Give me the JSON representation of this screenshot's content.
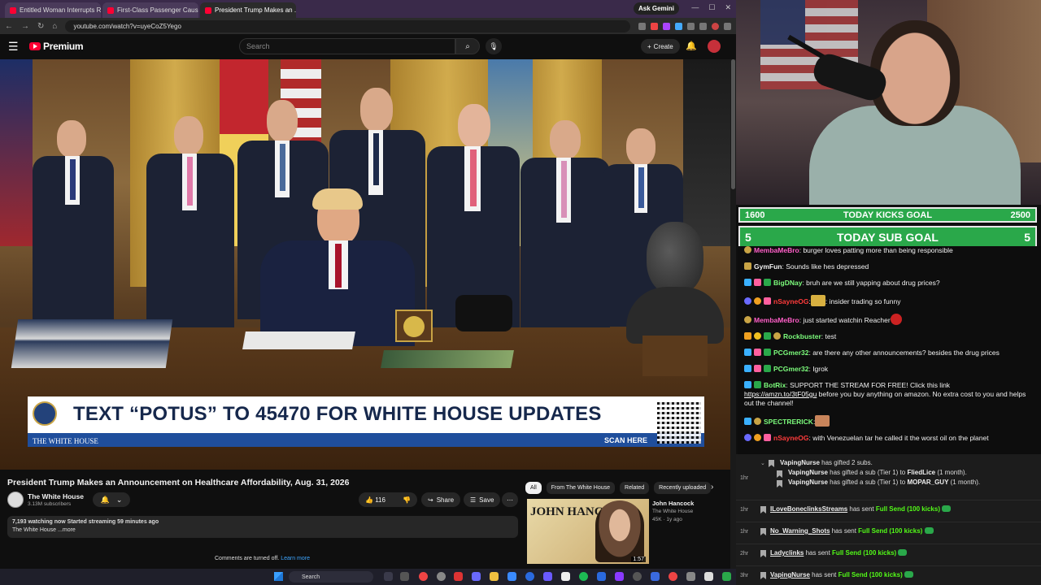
{
  "browser": {
    "tabs": [
      {
        "label": "Entitled Woman Interrupts Rai...",
        "active": false
      },
      {
        "label": "First-Class Passenger Causes a...",
        "active": false
      },
      {
        "label": "President Trump Makes an ...",
        "active": true
      }
    ],
    "ask_gemini": "Ask Gemini",
    "url": "youtube.com/watch?v=uyeCoZ5Yego"
  },
  "youtube": {
    "logo_text": "Premium",
    "search_placeholder": "Search",
    "create_label": "Create",
    "video": {
      "banner_text": "TEXT “POTUS” TO 45470 FOR WHITE HOUSE UPDATES",
      "banner_brand": "THE WHITE HOUSE",
      "banner_scan": "SCAN HERE"
    },
    "title": "President Trump Makes an Announcement on Healthcare Affordability, Aug. 31, 2026",
    "channel": {
      "name": "The White House",
      "subs": "3.13M subscribers"
    },
    "likes": "116",
    "share_label": "Share",
    "save_label": "Save",
    "description": {
      "stats": "7,193 watching now  Started streaming 59 minutes ago",
      "text": "The White House ...more"
    },
    "comments_off": "Comments are turned off.",
    "learn_more": "Learn more",
    "chips": [
      "All",
      "From The White House",
      "Related",
      "Recently uploaded"
    ],
    "related": {
      "thumb_text": "JOHN HANCOCK",
      "duration": "1:57",
      "title": "John Hancock",
      "channel": "The White House",
      "meta": "45K · 1y ago"
    }
  },
  "taskbar": {
    "search_label": "Search"
  },
  "overlay": {
    "kicks_goal": {
      "left": "1600",
      "label": "TODAY KICKS GOAL",
      "right": "2500"
    },
    "sub_goal": {
      "left": "5",
      "label": "TODAY SUB GOAL",
      "right": "5"
    }
  },
  "chat": [
    {
      "user": "MembaMeBro",
      "user_color": "#ff5fc8",
      "text": ": burger loves patting more than being responsible"
    },
    {
      "user": "GymFun",
      "user_color": "#ffffff",
      "text": ": Sounds like hes depressed"
    },
    {
      "user": "BigDNay",
      "user_color": "#7cfc7c",
      "text": ": bruh are we still yapping about drug prices?"
    },
    {
      "user": "nSayneOG",
      "user_color": "#ff3b3b",
      "text": ": insider trading so funny"
    },
    {
      "user": "MembaMeBro",
      "user_color": "#ff5fc8",
      "text": ": just started watchin Reacher"
    },
    {
      "user": "Rockbuster",
      "user_color": "#7cfc7c",
      "text": ": test"
    },
    {
      "user": "PCGmer32",
      "user_color": "#7cfc7c",
      "text": ": are there any other announcements? besides the drug prices"
    },
    {
      "user": "PCGmer32",
      "user_color": "#7cfc7c",
      "text": ": Igrok"
    },
    {
      "user": "BotRix",
      "user_color": "#7cfc7c",
      "text": ": SUPPORT THE STREAM FOR FREE! Click this link ",
      "link": "https://amzn.to/3tF05gu",
      "text2": " before you buy anything on amazon. No extra cost to you and helps out the channel!"
    },
    {
      "user": "SPECTRERICK",
      "user_color": "#7cfc7c",
      "text": ":"
    },
    {
      "user": "nSayneOG",
      "user_color": "#ff3b3b",
      "text": ": with Venezuelan tar he called it the worst oil on the planet"
    }
  ],
  "events": {
    "gift_header": {
      "user": "VapingNurse",
      "text": " has gifted 2 subs."
    },
    "gift_lines": [
      {
        "user": "VapingNurse",
        "text": " has gifted a sub (Tier 1) to ",
        "to": "FliedLice",
        "tail": " (1 month)."
      },
      {
        "user": "VapingNurse",
        "text": " has gifted a sub (Tier 1) to ",
        "to": "MOPAR_GUY",
        "tail": " (1 month)."
      }
    ],
    "gift_time": "1hr",
    "sends": [
      {
        "time": "1hr",
        "user": "ILoveBoneclinksStreams",
        "text": " has sent ",
        "amount": "Full Send (100 kicks)"
      },
      {
        "time": "1hr",
        "user": "No_Warning_Shots",
        "text": " has sent ",
        "amount": "Full Send (100 kicks)"
      },
      {
        "time": "2hr",
        "user": "Ladyclinks",
        "text": " has sent ",
        "amount": "Full Send (100 kicks)"
      },
      {
        "time": "3hr",
        "user": "VapingNurse",
        "text": " has sent ",
        "amount": "Full Send (100 kicks)"
      }
    ]
  }
}
